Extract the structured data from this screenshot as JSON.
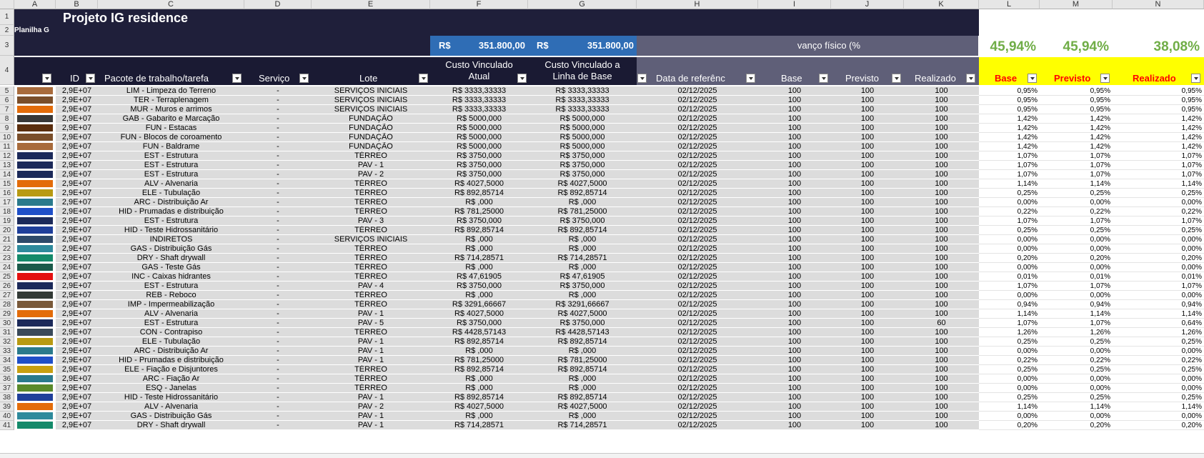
{
  "columns": [
    "A",
    "B",
    "C",
    "D",
    "E",
    "F",
    "G",
    "H",
    "I",
    "J",
    "K",
    "L",
    "M",
    "N"
  ],
  "title": "Projeto IG residence",
  "subtitle": "Planilha G",
  "cost_total_label": "R$",
  "cost_total_actual": "351.800,00",
  "cost_total_base": "351.800,00",
  "avanco_label": "vanço físico (%",
  "pct_base": "45,94%",
  "pct_previsto": "45,94%",
  "pct_realizado": "38,08%",
  "headers": {
    "id": "ID",
    "pacote": "Pacote de trabalho/tarefa",
    "servico": "Serviço",
    "lote": "Lote",
    "custo_atual_1": "Custo Vinculado",
    "custo_atual_2": "Atual",
    "custo_base_1": "Custo Vinculado a",
    "custo_base_2": "Linha de Base",
    "data": "Data de referênc",
    "base": "Base",
    "previsto": "Previsto",
    "realizado": "Realizado",
    "l_base": "Base",
    "l_previsto": "Previsto",
    "l_realizado": "Realizado"
  },
  "rows": [
    {
      "n": "5",
      "color": "#a86b3c",
      "id": "2,9E+07",
      "pacote": "LIM - Limpeza do Terreno",
      "servico": "-",
      "lote": "SERVIÇOS INICIAIS",
      "atual": "R$ 3333,33333",
      "base_cost": "R$ 3333,33333",
      "data": "02/12/2025",
      "b": "100",
      "p": "100",
      "r": "100",
      "lb": "0,95%",
      "lp": "0,95%",
      "lr": "0,95%"
    },
    {
      "n": "6",
      "color": "#7a4e2a",
      "id": "2,9E+07",
      "pacote": "TER - Terraplenagem",
      "servico": "-",
      "lote": "SERVIÇOS INICIAIS",
      "atual": "R$ 3333,33333",
      "base_cost": "R$ 3333,33333",
      "data": "02/12/2025",
      "b": "100",
      "p": "100",
      "r": "100",
      "lb": "0,95%",
      "lp": "0,95%",
      "lr": "0,95%"
    },
    {
      "n": "7",
      "color": "#e36c0a",
      "id": "2,9E+07",
      "pacote": "MUR - Muros e arrimos",
      "servico": "-",
      "lote": "SERVIÇOS INICIAIS",
      "atual": "R$ 3333,33333",
      "base_cost": "R$ 3333,33333",
      "data": "02/12/2025",
      "b": "100",
      "p": "100",
      "r": "100",
      "lb": "0,95%",
      "lp": "0,95%",
      "lr": "0,95%"
    },
    {
      "n": "8",
      "color": "#383838",
      "id": "2,9E+07",
      "pacote": "GAB - Gabarito e Marcação",
      "servico": "-",
      "lote": "FUNDAÇÃO",
      "atual": "R$ 5000,000",
      "base_cost": "R$ 5000,000",
      "data": "02/12/2025",
      "b": "100",
      "p": "100",
      "r": "100",
      "lb": "1,42%",
      "lp": "1,42%",
      "lr": "1,42%"
    },
    {
      "n": "9",
      "color": "#5a2e0e",
      "id": "2,9E+07",
      "pacote": "FUN - Estacas",
      "servico": "-",
      "lote": "FUNDAÇÃO",
      "atual": "R$ 5000,000",
      "base_cost": "R$ 5000,000",
      "data": "02/12/2025",
      "b": "100",
      "p": "100",
      "r": "100",
      "lb": "1,42%",
      "lp": "1,42%",
      "lr": "1,42%"
    },
    {
      "n": "10",
      "color": "#7a4e2a",
      "id": "2,9E+07",
      "pacote": "FUN - Blocos de coroamento",
      "servico": "-",
      "lote": "FUNDAÇÃO",
      "atual": "R$ 5000,000",
      "base_cost": "R$ 5000,000",
      "data": "02/12/2025",
      "b": "100",
      "p": "100",
      "r": "100",
      "lb": "1,42%",
      "lp": "1,42%",
      "lr": "1,42%"
    },
    {
      "n": "11",
      "color": "#a86b3c",
      "id": "2,9E+07",
      "pacote": "FUN - Baldrame",
      "servico": "-",
      "lote": "FUNDAÇÃO",
      "atual": "R$ 5000,000",
      "base_cost": "R$ 5000,000",
      "data": "02/12/2025",
      "b": "100",
      "p": "100",
      "r": "100",
      "lb": "1,42%",
      "lp": "1,42%",
      "lr": "1,42%"
    },
    {
      "n": "12",
      "color": "#1c2a5a",
      "id": "2,9E+07",
      "pacote": "EST - Estrutura",
      "servico": "-",
      "lote": "TÉRREO",
      "atual": "R$ 3750,000",
      "base_cost": "R$ 3750,000",
      "data": "02/12/2025",
      "b": "100",
      "p": "100",
      "r": "100",
      "lb": "1,07%",
      "lp": "1,07%",
      "lr": "1,07%"
    },
    {
      "n": "13",
      "color": "#1c2a5a",
      "id": "2,9E+07",
      "pacote": "EST - Estrutura",
      "servico": "-",
      "lote": "PAV - 1",
      "atual": "R$ 3750,000",
      "base_cost": "R$ 3750,000",
      "data": "02/12/2025",
      "b": "100",
      "p": "100",
      "r": "100",
      "lb": "1,07%",
      "lp": "1,07%",
      "lr": "1,07%"
    },
    {
      "n": "14",
      "color": "#1c2a5a",
      "id": "2,9E+07",
      "pacote": "EST - Estrutura",
      "servico": "-",
      "lote": "PAV - 2",
      "atual": "R$ 3750,000",
      "base_cost": "R$ 3750,000",
      "data": "02/12/2025",
      "b": "100",
      "p": "100",
      "r": "100",
      "lb": "1,07%",
      "lp": "1,07%",
      "lr": "1,07%"
    },
    {
      "n": "15",
      "color": "#e36c0a",
      "id": "2,9E+07",
      "pacote": "ALV - Alvenaria",
      "servico": "-",
      "lote": "TÉRREO",
      "atual": "R$ 4027,5000",
      "base_cost": "R$ 4027,5000",
      "data": "02/12/2025",
      "b": "100",
      "p": "100",
      "r": "100",
      "lb": "1,14%",
      "lp": "1,14%",
      "lr": "1,14%"
    },
    {
      "n": "16",
      "color": "#b89a12",
      "id": "2,9E+07",
      "pacote": "ELE - Tubulação",
      "servico": "-",
      "lote": "TÉRREO",
      "atual": "R$ 892,85714",
      "base_cost": "R$ 892,85714",
      "data": "02/12/2025",
      "b": "100",
      "p": "100",
      "r": "100",
      "lb": "0,25%",
      "lp": "0,25%",
      "lr": "0,25%"
    },
    {
      "n": "17",
      "color": "#2a7a8c",
      "id": "2,9E+07",
      "pacote": "ARC - Distribuição Ar",
      "servico": "-",
      "lote": "TÉRREO",
      "atual": "R$ ,000",
      "base_cost": "R$ ,000",
      "data": "02/12/2025",
      "b": "100",
      "p": "100",
      "r": "100",
      "lb": "0,00%",
      "lp": "0,00%",
      "lr": "0,00%"
    },
    {
      "n": "18",
      "color": "#1f4fc8",
      "id": "2,9E+07",
      "pacote": "HID - Prumadas e distribuição",
      "servico": "-",
      "lote": "TÉRREO",
      "atual": "R$ 781,25000",
      "base_cost": "R$ 781,25000",
      "data": "02/12/2025",
      "b": "100",
      "p": "100",
      "r": "100",
      "lb": "0,22%",
      "lp": "0,22%",
      "lr": "0,22%"
    },
    {
      "n": "19",
      "color": "#1c2a5a",
      "id": "2,9E+07",
      "pacote": "EST - Estrutura",
      "servico": "-",
      "lote": "PAV - 3",
      "atual": "R$ 3750,000",
      "base_cost": "R$ 3750,000",
      "data": "02/12/2025",
      "b": "100",
      "p": "100",
      "r": "100",
      "lb": "1,07%",
      "lp": "1,07%",
      "lr": "1,07%"
    },
    {
      "n": "20",
      "color": "#1f3f9a",
      "id": "2,9E+07",
      "pacote": "HID - Teste Hidrossanitário",
      "servico": "-",
      "lote": "TÉRREO",
      "atual": "R$ 892,85714",
      "base_cost": "R$ 892,85714",
      "data": "02/12/2025",
      "b": "100",
      "p": "100",
      "r": "100",
      "lb": "0,25%",
      "lp": "0,25%",
      "lr": "0,25%"
    },
    {
      "n": "21",
      "color": "#2e4a6a",
      "id": "2,9E+07",
      "pacote": "INDIRETOS",
      "servico": "-",
      "lote": "SERVIÇOS INICIAIS",
      "atual": "R$ ,000",
      "base_cost": "R$ ,000",
      "data": "02/12/2025",
      "b": "100",
      "p": "100",
      "r": "100",
      "lb": "0,00%",
      "lp": "0,00%",
      "lr": "0,00%"
    },
    {
      "n": "22",
      "color": "#2e8a9c",
      "id": "2,9E+07",
      "pacote": "GAS - Distribuição Gás",
      "servico": "-",
      "lote": "TÉRREO",
      "atual": "R$ ,000",
      "base_cost": "R$ ,000",
      "data": "02/12/2025",
      "b": "100",
      "p": "100",
      "r": "100",
      "lb": "0,00%",
      "lp": "0,00%",
      "lr": "0,00%"
    },
    {
      "n": "23",
      "color": "#148a6a",
      "id": "2,9E+07",
      "pacote": "DRY - Shaft drywall",
      "servico": "-",
      "lote": "TÉRREO",
      "atual": "R$ 714,28571",
      "base_cost": "R$ 714,28571",
      "data": "02/12/2025",
      "b": "100",
      "p": "100",
      "r": "100",
      "lb": "0,20%",
      "lp": "0,20%",
      "lr": "0,20%"
    },
    {
      "n": "24",
      "color": "#1a5a4a",
      "id": "2,9E+07",
      "pacote": "GAS - Teste Gás",
      "servico": "-",
      "lote": "TÉRREO",
      "atual": "R$ ,000",
      "base_cost": "R$ ,000",
      "data": "02/12/2025",
      "b": "100",
      "p": "100",
      "r": "100",
      "lb": "0,00%",
      "lp": "0,00%",
      "lr": "0,00%"
    },
    {
      "n": "25",
      "color": "#e41010",
      "id": "2,9E+07",
      "pacote": "INC - Caixas hidrantes",
      "servico": "-",
      "lote": "TÉRREO",
      "atual": "R$ 47,61905",
      "base_cost": "R$ 47,61905",
      "data": "02/12/2025",
      "b": "100",
      "p": "100",
      "r": "100",
      "lb": "0,01%",
      "lp": "0,01%",
      "lr": "0,01%"
    },
    {
      "n": "26",
      "color": "#1c2a5a",
      "id": "2,9E+07",
      "pacote": "EST - Estrutura",
      "servico": "-",
      "lote": "PAV - 4",
      "atual": "R$ 3750,000",
      "base_cost": "R$ 3750,000",
      "data": "02/12/2025",
      "b": "100",
      "p": "100",
      "r": "100",
      "lb": "1,07%",
      "lp": "1,07%",
      "lr": "1,07%"
    },
    {
      "n": "27",
      "color": "#333a36",
      "id": "2,9E+07",
      "pacote": "REB - Reboco",
      "servico": "-",
      "lote": "TÉRREO",
      "atual": "R$ ,000",
      "base_cost": "R$ ,000",
      "data": "02/12/2025",
      "b": "100",
      "p": "100",
      "r": "100",
      "lb": "0,00%",
      "lp": "0,00%",
      "lr": "0,00%"
    },
    {
      "n": "28",
      "color": "#7a5a3a",
      "id": "2,9E+07",
      "pacote": "IMP - Impermeabilização",
      "servico": "-",
      "lote": "TÉRREO",
      "atual": "R$ 3291,66667",
      "base_cost": "R$ 3291,66667",
      "data": "02/12/2025",
      "b": "100",
      "p": "100",
      "r": "100",
      "lb": "0,94%",
      "lp": "0,94%",
      "lr": "0,94%"
    },
    {
      "n": "29",
      "color": "#e36c0a",
      "id": "2,9E+07",
      "pacote": "ALV - Alvenaria",
      "servico": "-",
      "lote": "PAV - 1",
      "atual": "R$ 4027,5000",
      "base_cost": "R$ 4027,5000",
      "data": "02/12/2025",
      "b": "100",
      "p": "100",
      "r": "100",
      "lb": "1,14%",
      "lp": "1,14%",
      "lr": "1,14%"
    },
    {
      "n": "30",
      "color": "#1c2a5a",
      "id": "2,9E+07",
      "pacote": "EST - Estrutura",
      "servico": "-",
      "lote": "PAV - 5",
      "atual": "R$ 3750,000",
      "base_cost": "R$ 3750,000",
      "data": "02/12/2025",
      "b": "100",
      "p": "100",
      "r": "60",
      "lb": "1,07%",
      "lp": "1,07%",
      "lr": "0,64%"
    },
    {
      "n": "31",
      "color": "#3a4a5a",
      "id": "2,9E+07",
      "pacote": "CON - Contrapiso",
      "servico": "-",
      "lote": "TÉRREO",
      "atual": "R$ 4428,57143",
      "base_cost": "R$ 4428,57143",
      "data": "02/12/2025",
      "b": "100",
      "p": "100",
      "r": "100",
      "lb": "1,26%",
      "lp": "1,26%",
      "lr": "1,26%"
    },
    {
      "n": "32",
      "color": "#b89a12",
      "id": "2,9E+07",
      "pacote": "ELE - Tubulação",
      "servico": "-",
      "lote": "PAV - 1",
      "atual": "R$ 892,85714",
      "base_cost": "R$ 892,85714",
      "data": "02/12/2025",
      "b": "100",
      "p": "100",
      "r": "100",
      "lb": "0,25%",
      "lp": "0,25%",
      "lr": "0,25%"
    },
    {
      "n": "33",
      "color": "#2a7a8c",
      "id": "2,9E+07",
      "pacote": "ARC - Distribuição Ar",
      "servico": "-",
      "lote": "PAV - 1",
      "atual": "R$ ,000",
      "base_cost": "R$ ,000",
      "data": "02/12/2025",
      "b": "100",
      "p": "100",
      "r": "100",
      "lb": "0,00%",
      "lp": "0,00%",
      "lr": "0,00%"
    },
    {
      "n": "34",
      "color": "#1f4fc8",
      "id": "2,9E+07",
      "pacote": "HID - Prumadas e distribuição",
      "servico": "-",
      "lote": "PAV - 1",
      "atual": "R$ 781,25000",
      "base_cost": "R$ 781,25000",
      "data": "02/12/2025",
      "b": "100",
      "p": "100",
      "r": "100",
      "lb": "0,22%",
      "lp": "0,22%",
      "lr": "0,22%"
    },
    {
      "n": "35",
      "color": "#c8a010",
      "id": "2,9E+07",
      "pacote": "ELE - Fiação e Disjuntores",
      "servico": "-",
      "lote": "TÉRREO",
      "atual": "R$ 892,85714",
      "base_cost": "R$ 892,85714",
      "data": "02/12/2025",
      "b": "100",
      "p": "100",
      "r": "100",
      "lb": "0,25%",
      "lp": "0,25%",
      "lr": "0,25%"
    },
    {
      "n": "36",
      "color": "#2a7a8c",
      "id": "2,9E+07",
      "pacote": "ARC - Fiação Ar",
      "servico": "-",
      "lote": "TÉRREO",
      "atual": "R$ ,000",
      "base_cost": "R$ ,000",
      "data": "02/12/2025",
      "b": "100",
      "p": "100",
      "r": "100",
      "lb": "0,00%",
      "lp": "0,00%",
      "lr": "0,00%"
    },
    {
      "n": "37",
      "color": "#5a8a2a",
      "id": "2,9E+07",
      "pacote": "ESQ - Janelas",
      "servico": "-",
      "lote": "TÉRREO",
      "atual": "R$ ,000",
      "base_cost": "R$ ,000",
      "data": "02/12/2025",
      "b": "100",
      "p": "100",
      "r": "100",
      "lb": "0,00%",
      "lp": "0,00%",
      "lr": "0,00%"
    },
    {
      "n": "38",
      "color": "#1f3f9a",
      "id": "2,9E+07",
      "pacote": "HID - Teste Hidrossanitário",
      "servico": "-",
      "lote": "PAV - 1",
      "atual": "R$ 892,85714",
      "base_cost": "R$ 892,85714",
      "data": "02/12/2025",
      "b": "100",
      "p": "100",
      "r": "100",
      "lb": "0,25%",
      "lp": "0,25%",
      "lr": "0,25%"
    },
    {
      "n": "39",
      "color": "#e36c0a",
      "id": "2,9E+07",
      "pacote": "ALV - Alvenaria",
      "servico": "-",
      "lote": "PAV - 2",
      "atual": "R$ 4027,5000",
      "base_cost": "R$ 4027,5000",
      "data": "02/12/2025",
      "b": "100",
      "p": "100",
      "r": "100",
      "lb": "1,14%",
      "lp": "1,14%",
      "lr": "1,14%"
    },
    {
      "n": "40",
      "color": "#2e8a9c",
      "id": "2,9E+07",
      "pacote": "GAS - Distribuição Gás",
      "servico": "-",
      "lote": "PAV - 1",
      "atual": "R$ ,000",
      "base_cost": "R$ ,000",
      "data": "02/12/2025",
      "b": "100",
      "p": "100",
      "r": "100",
      "lb": "0,00%",
      "lp": "0,00%",
      "lr": "0,00%"
    },
    {
      "n": "41",
      "color": "#148a6a",
      "id": "2,9E+07",
      "pacote": "DRY - Shaft drywall",
      "servico": "-",
      "lote": "PAV - 1",
      "atual": "R$ 714,28571",
      "base_cost": "R$ 714,28571",
      "data": "02/12/2025",
      "b": "100",
      "p": "100",
      "r": "100",
      "lb": "0,20%",
      "lp": "0,20%",
      "lr": "0,20%"
    }
  ]
}
